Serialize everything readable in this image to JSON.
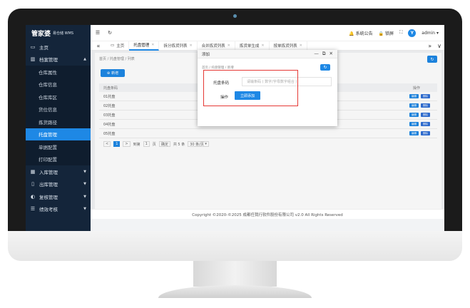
{
  "brand": {
    "name": "管家婆",
    "subtitle": "易仓储 WMS"
  },
  "sidebar": {
    "items": [
      {
        "label": "主页",
        "icon": "monitor-icon"
      },
      {
        "label": "档案管理",
        "icon": "books-icon",
        "expanded": true
      }
    ],
    "sub_items": [
      "仓库属性",
      "仓库信息",
      "仓库库区",
      "货位信息",
      "拣货路径",
      "托盘管理",
      "单据配置",
      "打印配置"
    ],
    "active_sub": "托盘管理",
    "lower_items": [
      {
        "label": "入库管理",
        "icon": "grid-icon"
      },
      {
        "label": "出库管理",
        "icon": "bars-icon"
      },
      {
        "label": "复核管理",
        "icon": "circle-icon"
      },
      {
        "label": "绩效考核",
        "icon": "list-icon"
      }
    ]
  },
  "topbar": {
    "menu_icon": "menu-icon",
    "refresh_icon": "refresh-icon",
    "announcement": "系统公告",
    "lock": "锁屏",
    "user": "admin",
    "avatar_letter": "Y"
  },
  "tabs": [
    {
      "label": "主页",
      "icon": "monitor-icon",
      "closable": false
    },
    {
      "label": "托盘管理",
      "closable": true,
      "active": true
    },
    {
      "label": "拆分拣货列表",
      "closable": true
    },
    {
      "label": "合并拣货列表",
      "closable": true
    },
    {
      "label": "拣货单生成",
      "closable": true
    },
    {
      "label": "按单拣货列表",
      "closable": true
    }
  ],
  "content": {
    "breadcrumb": "首页 / 托盘管理 / 列表",
    "add_button": "新增",
    "columns": [
      "托盘条码",
      "操作"
    ],
    "rows": [
      "01托盘",
      "02托盘",
      "03托盘",
      "04托盘",
      "05托盘"
    ],
    "op_edit": "编辑",
    "op_delete": "删除",
    "pager": {
      "prev": "<",
      "current": "1",
      "next": ">",
      "goto_label": "到第",
      "goto_value": "1",
      "page_unit": "页",
      "confirm": "确定",
      "total": "共 5 条",
      "per_page": "30 条/页"
    }
  },
  "footer": "Copyright ©2020-©2025 成都任我行软件股份有限公司 v2.0 All Rights Reserved",
  "modal": {
    "title": "添加",
    "breadcrumb": "首页 / 托盘管理 / 新增",
    "field_label": "托盘条码",
    "field_placeholder": "请输条码 ( 数字/字母数字组合 )",
    "op_label": "操作",
    "submit": "立即添加"
  },
  "colors": {
    "accent": "#1e88e5",
    "sidebar_bg": "#14253a",
    "highlight": "#e53935"
  }
}
